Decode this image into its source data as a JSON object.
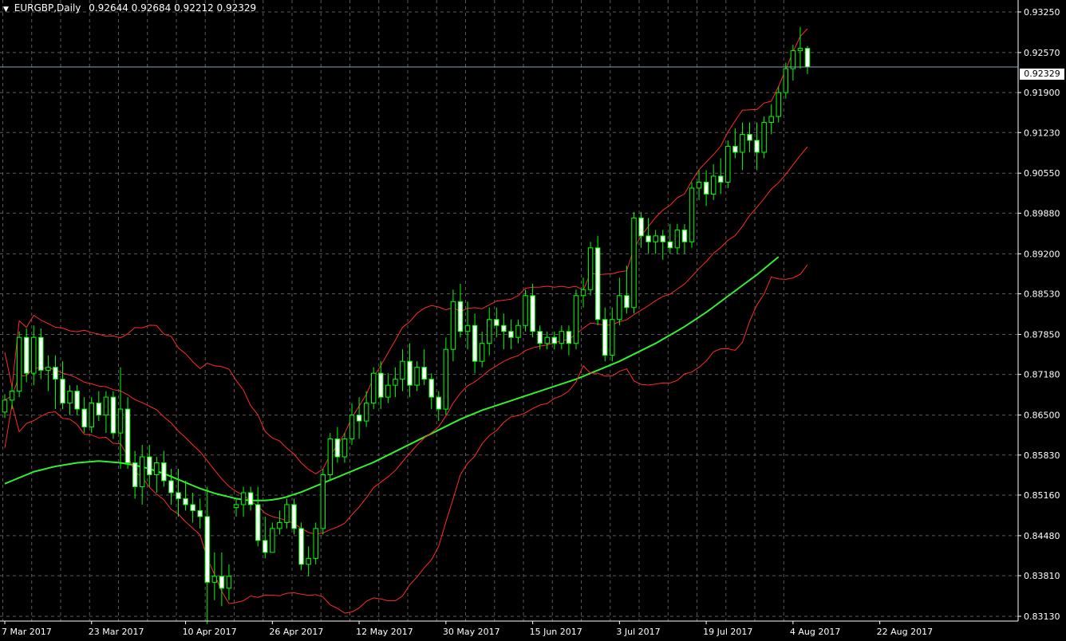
{
  "header": {
    "symbol_tf": "EURGBP,Daily",
    "ohlc": "0.92644 0.92684 0.92212 0.92329"
  },
  "current_price_label": "0.92329",
  "colors": {
    "background": "#000000",
    "grid": "#5a5a5a",
    "axis": "#ffffff",
    "text": "#ffffff",
    "candle_up": "#000000",
    "candle_down": "#ffffff",
    "wick": "#00ff00",
    "bollinger": "#ff2a2a",
    "ma": "#33ee33",
    "current_line": "#8aa0c0"
  },
  "chart_data": {
    "type": "candlestick",
    "title": "EURGBP,Daily",
    "y_ticks": [
      0.9325,
      0.9257,
      0.919,
      0.9123,
      0.9055,
      0.8988,
      0.892,
      0.8853,
      0.8785,
      0.8718,
      0.865,
      0.8583,
      0.8516,
      0.8448,
      0.8381,
      0.8313
    ],
    "y_tick_labels": [
      "0.93250",
      "0.92570",
      "0.91900",
      "0.91230",
      "0.90550",
      "0.89880",
      "0.89200",
      "0.88530",
      "0.87850",
      "0.87180",
      "0.86500",
      "0.85830",
      "0.85160",
      "0.84480",
      "0.83810",
      "0.83130"
    ],
    "ylim": [
      0.8305,
      0.9345
    ],
    "x_labels": [
      {
        "text": "7 Mar 2017",
        "index": 0
      },
      {
        "text": "23 Mar 2017",
        "index": 12
      },
      {
        "text": "10 Apr 2017",
        "index": 25
      },
      {
        "text": "26 Apr 2017",
        "index": 37
      },
      {
        "text": "12 May 2017",
        "index": 49
      },
      {
        "text": "30 May 2017",
        "index": 61
      },
      {
        "text": "15 Jun 2017",
        "index": 73
      },
      {
        "text": "3 Jul 2017",
        "index": 85
      },
      {
        "text": "19 Jul 2017",
        "index": 97
      },
      {
        "text": "4 Aug 2017",
        "index": 109
      },
      {
        "text": "22 Aug 2017",
        "index": 121
      }
    ],
    "candles": [
      [
        0.8655,
        0.8685,
        0.8645,
        0.8675
      ],
      [
        0.8675,
        0.87,
        0.866,
        0.869
      ],
      [
        0.869,
        0.879,
        0.868,
        0.878
      ],
      [
        0.878,
        0.8795,
        0.8705,
        0.872
      ],
      [
        0.872,
        0.88,
        0.87,
        0.878
      ],
      [
        0.878,
        0.8795,
        0.871,
        0.8725
      ],
      [
        0.8725,
        0.875,
        0.869,
        0.873
      ],
      [
        0.873,
        0.875,
        0.866,
        0.871
      ],
      [
        0.871,
        0.874,
        0.866,
        0.867
      ],
      [
        0.867,
        0.87,
        0.865,
        0.869
      ],
      [
        0.869,
        0.87,
        0.865,
        0.866
      ],
      [
        0.866,
        0.868,
        0.862,
        0.863
      ],
      [
        0.863,
        0.868,
        0.862,
        0.867
      ],
      [
        0.867,
        0.869,
        0.864,
        0.865
      ],
      [
        0.865,
        0.869,
        0.862,
        0.868
      ],
      [
        0.868,
        0.869,
        0.861,
        0.862
      ],
      [
        0.862,
        0.873,
        0.856,
        0.866
      ],
      [
        0.866,
        0.868,
        0.856,
        0.857
      ],
      [
        0.857,
        0.859,
        0.851,
        0.853
      ],
      [
        0.853,
        0.86,
        0.85,
        0.858
      ],
      [
        0.858,
        0.86,
        0.853,
        0.855
      ],
      [
        0.855,
        0.858,
        0.852,
        0.857
      ],
      [
        0.857,
        0.859,
        0.853,
        0.854
      ],
      [
        0.854,
        0.856,
        0.85,
        0.852
      ],
      [
        0.852,
        0.856,
        0.848,
        0.851
      ],
      [
        0.851,
        0.854,
        0.849,
        0.85
      ],
      [
        0.85,
        0.852,
        0.847,
        0.849
      ],
      [
        0.849,
        0.851,
        0.846,
        0.848
      ],
      [
        0.848,
        0.853,
        0.83,
        0.837
      ],
      [
        0.837,
        0.842,
        0.834,
        0.838
      ],
      [
        0.838,
        0.842,
        0.833,
        0.836
      ],
      [
        0.836,
        0.84,
        0.834,
        0.838
      ],
      [
        0.8495,
        0.851,
        0.848,
        0.85
      ],
      [
        0.85,
        0.853,
        0.848,
        0.852
      ],
      [
        0.852,
        0.853,
        0.849,
        0.85
      ],
      [
        0.85,
        0.853,
        0.843,
        0.844
      ],
      [
        0.844,
        0.848,
        0.841,
        0.842
      ],
      [
        0.842,
        0.847,
        0.842,
        0.846
      ],
      [
        0.846,
        0.849,
        0.845,
        0.847
      ],
      [
        0.847,
        0.851,
        0.846,
        0.85
      ],
      [
        0.85,
        0.851,
        0.845,
        0.846
      ],
      [
        0.846,
        0.847,
        0.839,
        0.84
      ],
      [
        0.84,
        0.843,
        0.838,
        0.841
      ],
      [
        0.841,
        0.847,
        0.84,
        0.846
      ],
      [
        0.846,
        0.856,
        0.845,
        0.855
      ],
      [
        0.855,
        0.862,
        0.854,
        0.861
      ],
      [
        0.861,
        0.863,
        0.857,
        0.858
      ],
      [
        0.858,
        0.862,
        0.857,
        0.861
      ],
      [
        0.861,
        0.867,
        0.86,
        0.865
      ],
      [
        0.865,
        0.868,
        0.861,
        0.864
      ],
      [
        0.864,
        0.869,
        0.863,
        0.867
      ],
      [
        0.867,
        0.873,
        0.866,
        0.872
      ],
      [
        0.872,
        0.874,
        0.866,
        0.868
      ],
      [
        0.868,
        0.872,
        0.867,
        0.87
      ],
      [
        0.87,
        0.873,
        0.868,
        0.871
      ],
      [
        0.871,
        0.876,
        0.869,
        0.874
      ],
      [
        0.874,
        0.877,
        0.868,
        0.87
      ],
      [
        0.87,
        0.874,
        0.869,
        0.873
      ],
      [
        0.873,
        0.876,
        0.87,
        0.871
      ],
      [
        0.871,
        0.872,
        0.866,
        0.868
      ],
      [
        0.868,
        0.869,
        0.864,
        0.866
      ],
      [
        0.866,
        0.878,
        0.865,
        0.876
      ],
      [
        0.876,
        0.886,
        0.874,
        0.884
      ],
      [
        0.884,
        0.887,
        0.878,
        0.879
      ],
      [
        0.879,
        0.884,
        0.876,
        0.88
      ],
      [
        0.88,
        0.882,
        0.872,
        0.874
      ],
      [
        0.874,
        0.879,
        0.873,
        0.877
      ],
      [
        0.877,
        0.883,
        0.875,
        0.881
      ],
      [
        0.881,
        0.883,
        0.878,
        0.88
      ],
      [
        0.88,
        0.882,
        0.876,
        0.879
      ],
      [
        0.879,
        0.881,
        0.876,
        0.878
      ],
      [
        0.878,
        0.881,
        0.877,
        0.88
      ],
      [
        0.88,
        0.886,
        0.879,
        0.885
      ],
      [
        0.885,
        0.887,
        0.878,
        0.879
      ],
      [
        0.879,
        0.88,
        0.876,
        0.877
      ],
      [
        0.877,
        0.879,
        0.876,
        0.878
      ],
      [
        0.878,
        0.879,
        0.876,
        0.877
      ],
      [
        0.877,
        0.88,
        0.876,
        0.879
      ],
      [
        0.879,
        0.88,
        0.875,
        0.877
      ],
      [
        0.877,
        0.886,
        0.876,
        0.885
      ],
      [
        0.885,
        0.888,
        0.883,
        0.886
      ],
      [
        0.886,
        0.894,
        0.885,
        0.893
      ],
      [
        0.893,
        0.895,
        0.88,
        0.881
      ],
      [
        0.881,
        0.883,
        0.874,
        0.875
      ],
      [
        0.875,
        0.883,
        0.874,
        0.881
      ],
      [
        0.881,
        0.888,
        0.88,
        0.885
      ],
      [
        0.885,
        0.89,
        0.882,
        0.883
      ],
      [
        0.883,
        0.899,
        0.882,
        0.898
      ],
      [
        0.898,
        0.899,
        0.893,
        0.895
      ],
      [
        0.895,
        0.898,
        0.892,
        0.894
      ],
      [
        0.894,
        0.896,
        0.892,
        0.895
      ],
      [
        0.895,
        0.896,
        0.891,
        0.894
      ],
      [
        0.894,
        0.897,
        0.892,
        0.893
      ],
      [
        0.893,
        0.897,
        0.892,
        0.896
      ],
      [
        0.896,
        0.897,
        0.892,
        0.894
      ],
      [
        0.894,
        0.904,
        0.893,
        0.903
      ],
      [
        0.903,
        0.906,
        0.901,
        0.904
      ],
      [
        0.904,
        0.906,
        0.9,
        0.902
      ],
      [
        0.902,
        0.907,
        0.901,
        0.905
      ],
      [
        0.905,
        0.908,
        0.902,
        0.904
      ],
      [
        0.904,
        0.911,
        0.903,
        0.91
      ],
      [
        0.91,
        0.913,
        0.908,
        0.909
      ],
      [
        0.909,
        0.914,
        0.906,
        0.912
      ],
      [
        0.912,
        0.914,
        0.909,
        0.911
      ],
      [
        0.911,
        0.914,
        0.906,
        0.909
      ],
      [
        0.909,
        0.915,
        0.908,
        0.914
      ],
      [
        0.914,
        0.917,
        0.912,
        0.915
      ],
      [
        0.915,
        0.92,
        0.914,
        0.919
      ],
      [
        0.919,
        0.924,
        0.918,
        0.923
      ],
      [
        0.923,
        0.927,
        0.921,
        0.926
      ],
      [
        0.926,
        0.93,
        0.923,
        0.9264
      ],
      [
        0.9264,
        0.9268,
        0.9221,
        0.9233
      ]
    ],
    "ma_values": [
      0.8535,
      0.854,
      0.8545,
      0.855,
      0.8555,
      0.8558,
      0.8561,
      0.8564,
      0.8566,
      0.8568,
      0.857,
      0.8571,
      0.8572,
      0.8573,
      0.8572,
      0.8571,
      0.857,
      0.8568,
      0.8566,
      0.8563,
      0.856,
      0.8556,
      0.8552,
      0.8547,
      0.8542,
      0.8537,
      0.8532,
      0.8527,
      0.8523,
      0.8519,
      0.8516,
      0.8513,
      0.851,
      0.8508,
      0.8507,
      0.8507,
      0.8507,
      0.8508,
      0.851,
      0.8513,
      0.8517,
      0.8521,
      0.8526,
      0.8531,
      0.8536,
      0.8541,
      0.8546,
      0.8551,
      0.8556,
      0.8561,
      0.8566,
      0.8571,
      0.8577,
      0.8583,
      0.8589,
      0.8595,
      0.8601,
      0.8607,
      0.8613,
      0.8619,
      0.8625,
      0.8631,
      0.8637,
      0.8643,
      0.8648,
      0.8653,
      0.8658,
      0.8662,
      0.8666,
      0.867,
      0.8674,
      0.8678,
      0.8682,
      0.8686,
      0.869,
      0.8694,
      0.8698,
      0.8702,
      0.8706,
      0.871,
      0.8715,
      0.872,
      0.8725,
      0.873,
      0.8735,
      0.874,
      0.8746,
      0.8752,
      0.8758,
      0.8764,
      0.877,
      0.8777,
      0.8784,
      0.8791,
      0.8798,
      0.8806,
      0.8814,
      0.8822,
      0.8831,
      0.884,
      0.8849,
      0.8858,
      0.8867,
      0.8876,
      0.8885,
      0.8895,
      0.8905,
      0.8915
    ]
  }
}
